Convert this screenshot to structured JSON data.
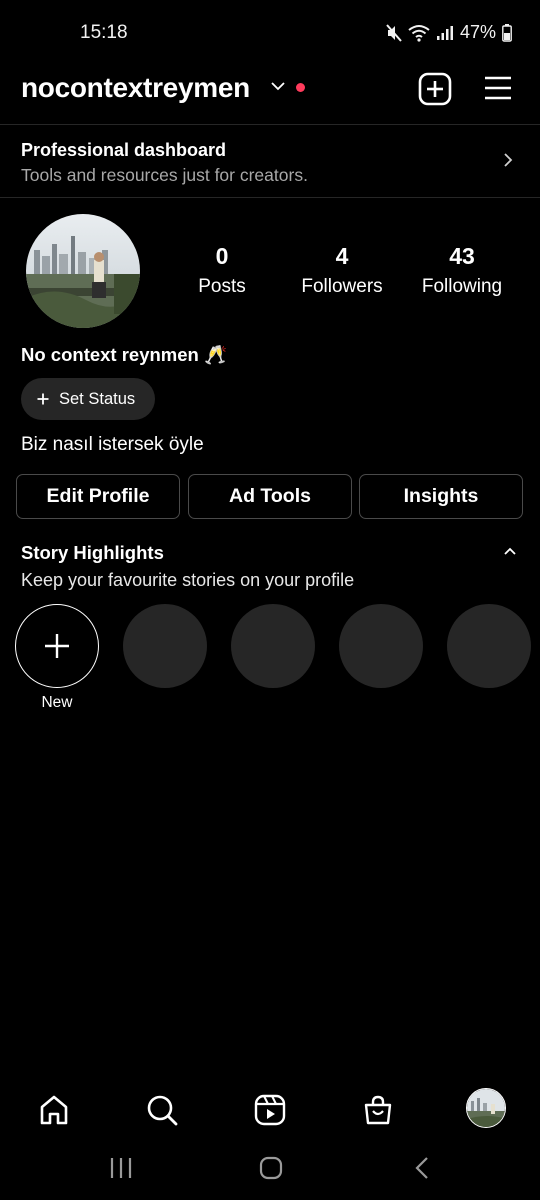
{
  "status_bar": {
    "time": "15:18",
    "battery": "47%",
    "icons": [
      "mute-icon",
      "wifi-icon",
      "signal-icon",
      "battery-icon"
    ]
  },
  "header": {
    "username": "nocontextreymen",
    "icons": [
      "chevron-down-icon",
      "notification-dot",
      "new-post-icon",
      "menu-icon"
    ]
  },
  "dashboard": {
    "title": "Professional dashboard",
    "subtitle": "Tools and resources just for creators."
  },
  "profile": {
    "stats": [
      {
        "value": "0",
        "label": "Posts"
      },
      {
        "value": "4",
        "label": "Followers"
      },
      {
        "value": "43",
        "label": "Following"
      }
    ],
    "display_name": "No context reynmen 🥂",
    "set_status_label": "Set Status",
    "bio": "Biz nasıl istersek öyle"
  },
  "actions": {
    "edit_profile": "Edit Profile",
    "ad_tools": "Ad Tools",
    "insights": "Insights"
  },
  "highlights": {
    "title": "Story Highlights",
    "subtitle": "Keep your favourite stories on your profile",
    "new_label": "New"
  },
  "bottom_nav": {
    "items": [
      "home-icon",
      "search-icon",
      "reels-icon",
      "shop-icon",
      "profile-avatar"
    ]
  },
  "colors": {
    "background": "#000000",
    "surface": "#262626",
    "border": "#4a4a4a",
    "secondary_text": "#a8a8a8",
    "notification": "#ff3b5c"
  }
}
